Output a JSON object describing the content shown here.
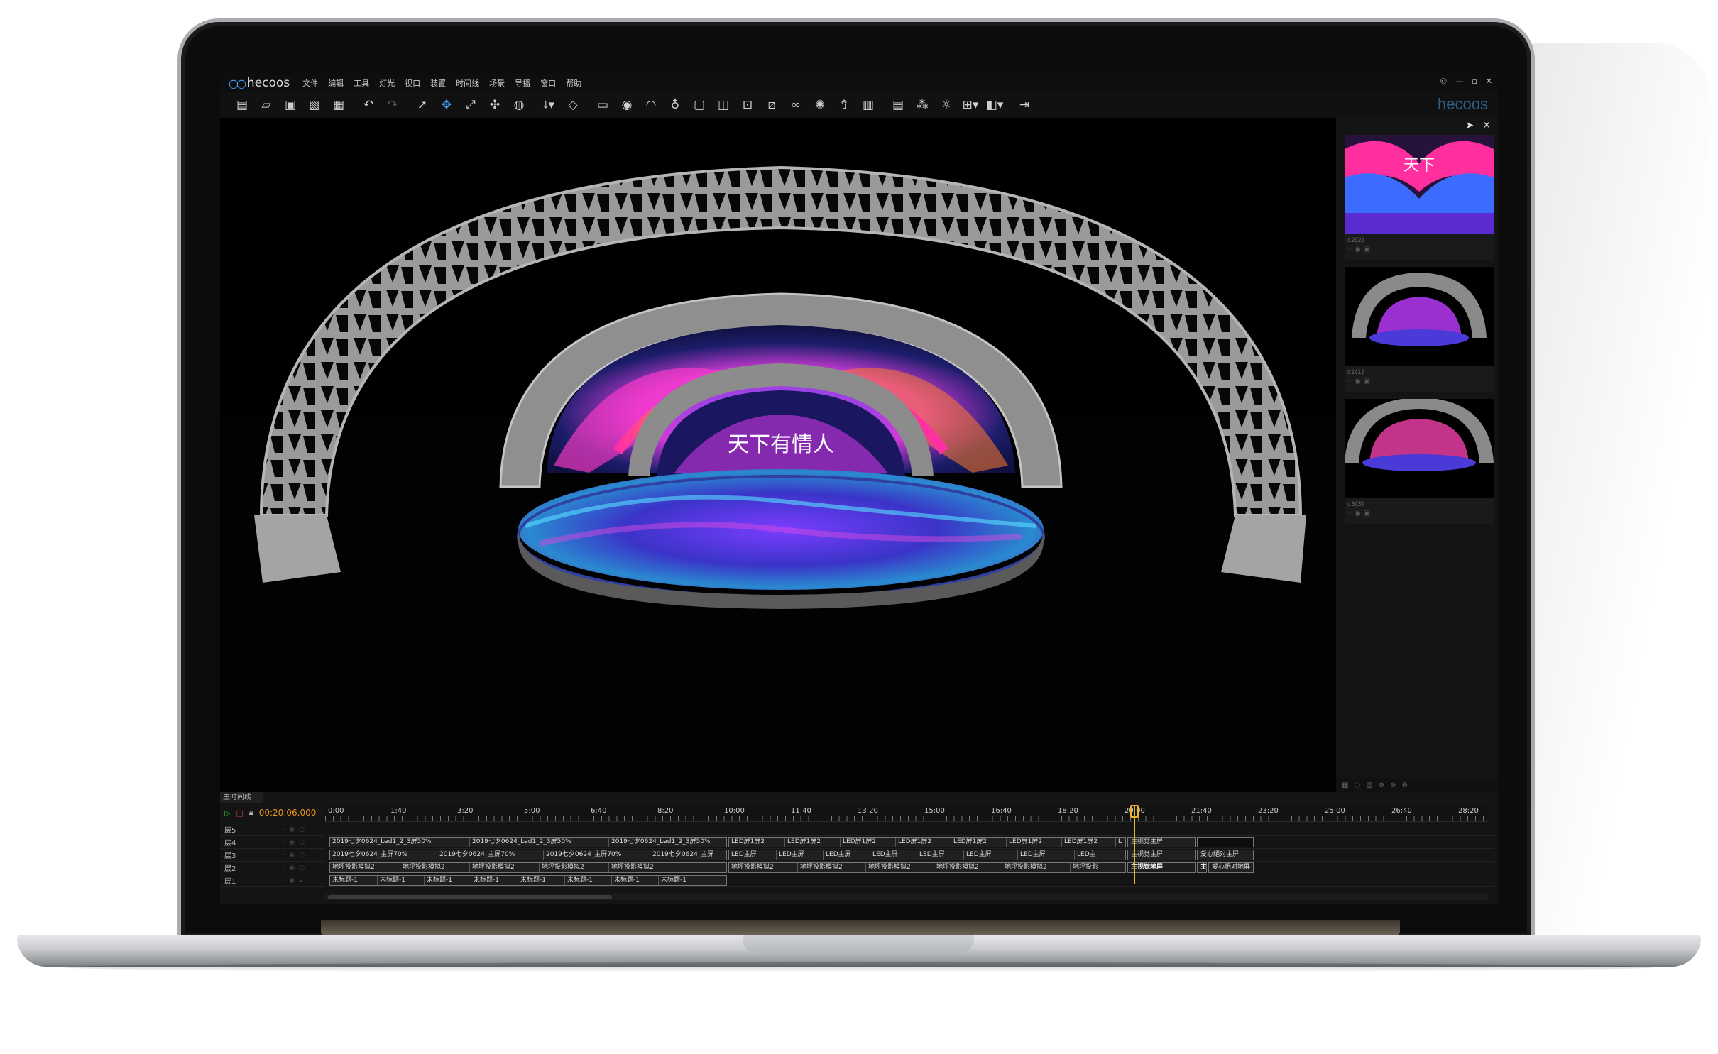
{
  "app": {
    "logo_text": "hecoos",
    "brand_text": "hecoos",
    "menu": [
      "文件",
      "编辑",
      "工具",
      "灯光",
      "视口",
      "装置",
      "时间线",
      "场景",
      "导播",
      "窗口",
      "帮助"
    ],
    "window_controls": [
      "⚇",
      "—",
      "▫",
      "✕"
    ]
  },
  "toolbar": {
    "icons": [
      "new-file-icon",
      "open-folder-icon",
      "save-icon",
      "save-as-icon",
      "package-icon",
      "undo-icon",
      "redo-icon",
      "select-icon",
      "move-icon",
      "scale-icon",
      "rotate-icon",
      "globe-icon",
      "import-icon",
      "cube-icon",
      "text-icon",
      "eye-icon",
      "camera-view-icon",
      "light-icon",
      "fps-icon",
      "snapshot-icon",
      "focus-icon",
      "ruler-icon",
      "link-icon",
      "sun-icon",
      "rocket-icon",
      "grid-icon",
      "layout-icon",
      "network-icon",
      "weather-icon",
      "multi-view-icon",
      "split-view-icon",
      "exit-icon"
    ]
  },
  "cameras": [
    {
      "label": "c2(2)"
    },
    {
      "label": "c1(1)"
    },
    {
      "label": "c3(3)"
    }
  ],
  "timeline": {
    "tab": "主时间线",
    "timecode": "00:20:06.000",
    "ticks": [
      "0:00",
      "1:40",
      "3:20",
      "5:00",
      "6:40",
      "8:20",
      "10:00",
      "11:40",
      "13:20",
      "15:00",
      "16:40",
      "18:20",
      "20:00",
      "21:40",
      "23:20",
      "25:00",
      "26:40",
      "28:20"
    ],
    "layers": [
      "层5",
      "层4",
      "层3",
      "层2",
      "层1"
    ],
    "clips": {
      "layer4": [
        "2019七夕0624_Led1_2_3屏50%",
        "2019七夕0624_Led1_2_3屏50%",
        "2019七夕0624_Led1_2_3屏50%",
        "LED屏1屏2",
        "LED屏1屏2",
        "LED屏1屏2",
        "LED屏1屏2",
        "LED屏1屏2",
        "LED屏1屏2",
        "LED屏1屏2",
        "L",
        "主视觉主屏"
      ],
      "layer3": [
        "2019七夕0624_主屏70%",
        "2019七夕0624_主屏70%",
        "2019七夕0624_主屏70%",
        "2019七夕0624_主屏",
        "LED主屏",
        "LED主屏",
        "LED主屏",
        "LED主屏",
        "LED主屏",
        "LED主屏",
        "LED主屏",
        "LED主",
        "主视觉主屏",
        "爱心絕对主屏"
      ],
      "layer2": [
        "地坪投影模拟2",
        "地坪投影模拟2",
        "地坪投影模拟2",
        "地坪投影模拟2",
        "地坪投影模拟2",
        "地坪投影模拟2",
        "地坪投影模拟2",
        "地坪投影模拟2",
        "地坪投影模拟2",
        "地坪投影模拟2",
        "地坪投影",
        "主视觉地屏",
        "主",
        "爱心絕对地屏"
      ],
      "layer1": [
        "未标题-1",
        "未标题-1",
        "未标题-1",
        "未标题-1",
        "未标题-1",
        "未标题-1",
        "未标题-1",
        "未标题-1"
      ]
    }
  },
  "colors": {
    "accent": "#4aa3ff",
    "timecode": "#e8921c",
    "playhead": "#e8b422"
  }
}
